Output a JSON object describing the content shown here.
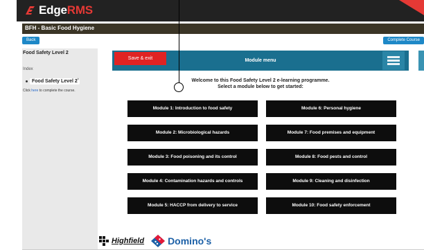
{
  "brand": {
    "name_main": "Edge",
    "name_accent": "RMS"
  },
  "course": {
    "title": "BFH - Basic Food Hygiene"
  },
  "actions": {
    "back": "Back",
    "complete": "Complete Course"
  },
  "sidebar": {
    "title": "Food Safety Level 2",
    "index_label": "Index",
    "item": {
      "label": "Food Safety Level 2",
      "caret": "^"
    },
    "note_prefix": "Click ",
    "note_link": "here",
    "note_suffix": " to complete the course."
  },
  "main": {
    "save_exit": "Save & exit",
    "menu_title": "Module menu",
    "welcome_line1": "Welcome to this Food Safety Level 2 e-learning programme.",
    "welcome_line2": "Select a module below to get started:"
  },
  "modules": [
    "Module 1: Introduction to food safety",
    "Module 6: Personal hygiene",
    "Module 2: Microbiological hazards",
    "Module 7: Food premises and equipment",
    "Module 3: Food poisoning and its control",
    "Module 8: Food pests and control",
    "Module 4: Contamination hazards and controls",
    "Module 9: Cleaning and disinfection",
    "Module 5: HACCP from delivery to service",
    "Module 10: Food safety enforcement"
  ],
  "partners": {
    "highfield": "Highfield",
    "dominos": "Domino's"
  },
  "colors": {
    "accent_red": "#e53935",
    "header_teal": "#1a6f8f",
    "button_blue": "#1e88c7",
    "module_bg": "#0d0d0d"
  },
  "icons": {
    "menu": "hamburger-icon",
    "logo": "edge-logo-icon"
  }
}
